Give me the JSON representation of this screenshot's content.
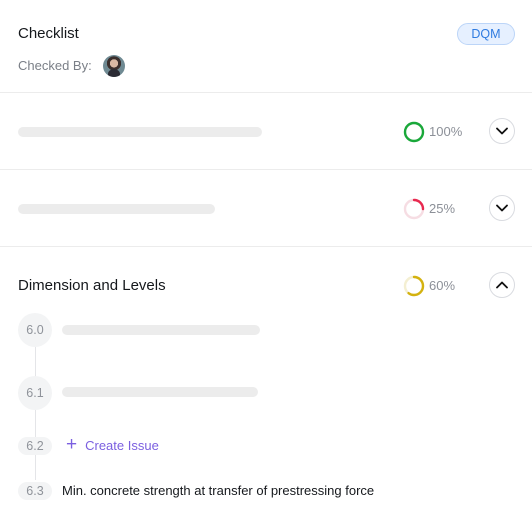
{
  "header": {
    "title": "Checklist",
    "badge": "DQM",
    "checked_by_label": "Checked By:"
  },
  "sections": [
    {
      "progress": 1.0,
      "percent_label": "100%",
      "color": "#1aa83a",
      "expanded": false
    },
    {
      "progress": 0.25,
      "percent_label": "25%",
      "color": "#e8294f",
      "expanded": false
    },
    {
      "title": "Dimension and Levels",
      "progress": 0.6,
      "percent_label": "60%",
      "color": "#d4b20f",
      "expanded": true
    }
  ],
  "steps": [
    {
      "number": "6.0"
    },
    {
      "number": "6.1"
    },
    {
      "number": "6.2",
      "action_label": "Create Issue"
    },
    {
      "number": "6.3",
      "text": "Min. concrete strength at transfer of prestressing force"
    }
  ],
  "colors": {
    "accent": "#7b5fe0",
    "badge_text": "#2f7be0",
    "badge_bg": "#e6f0ff"
  }
}
